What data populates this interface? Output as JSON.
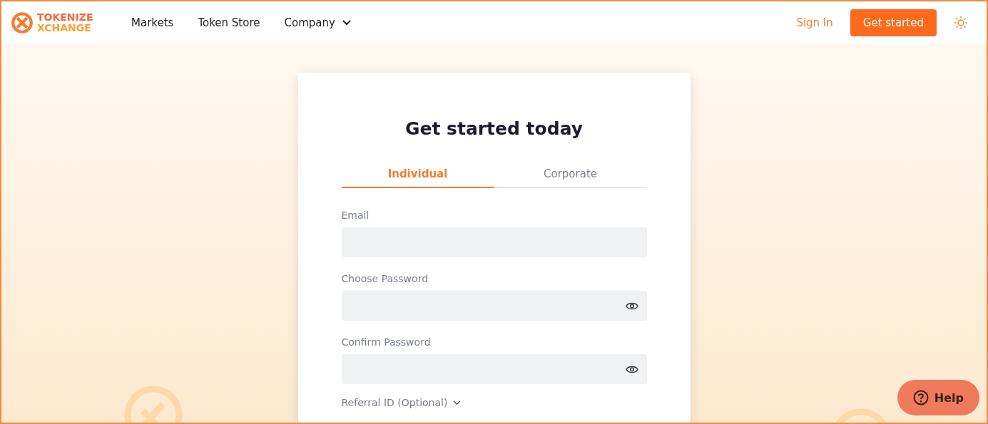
{
  "nav": {
    "logo": [
      "TOKENIZE",
      "XCHANGE"
    ],
    "links": [
      {
        "label": "Markets",
        "dropdown": false
      },
      {
        "label": "Token Store",
        "dropdown": false
      },
      {
        "label": "Company",
        "dropdown": true
      }
    ],
    "sign_in": "Sign In",
    "cta": "Get started"
  },
  "card": {
    "title": "Get started today",
    "tabs": [
      {
        "label": "Individual",
        "selected": true
      },
      {
        "label": "Corporate",
        "selected": false
      }
    ],
    "fields": [
      {
        "label": "Email",
        "kind": "text"
      },
      {
        "label": "Choose Password",
        "kind": "password"
      },
      {
        "label": "Confirm Password",
        "kind": "password"
      }
    ],
    "referral": "Referral ID (Optional)"
  },
  "help": "Help"
}
